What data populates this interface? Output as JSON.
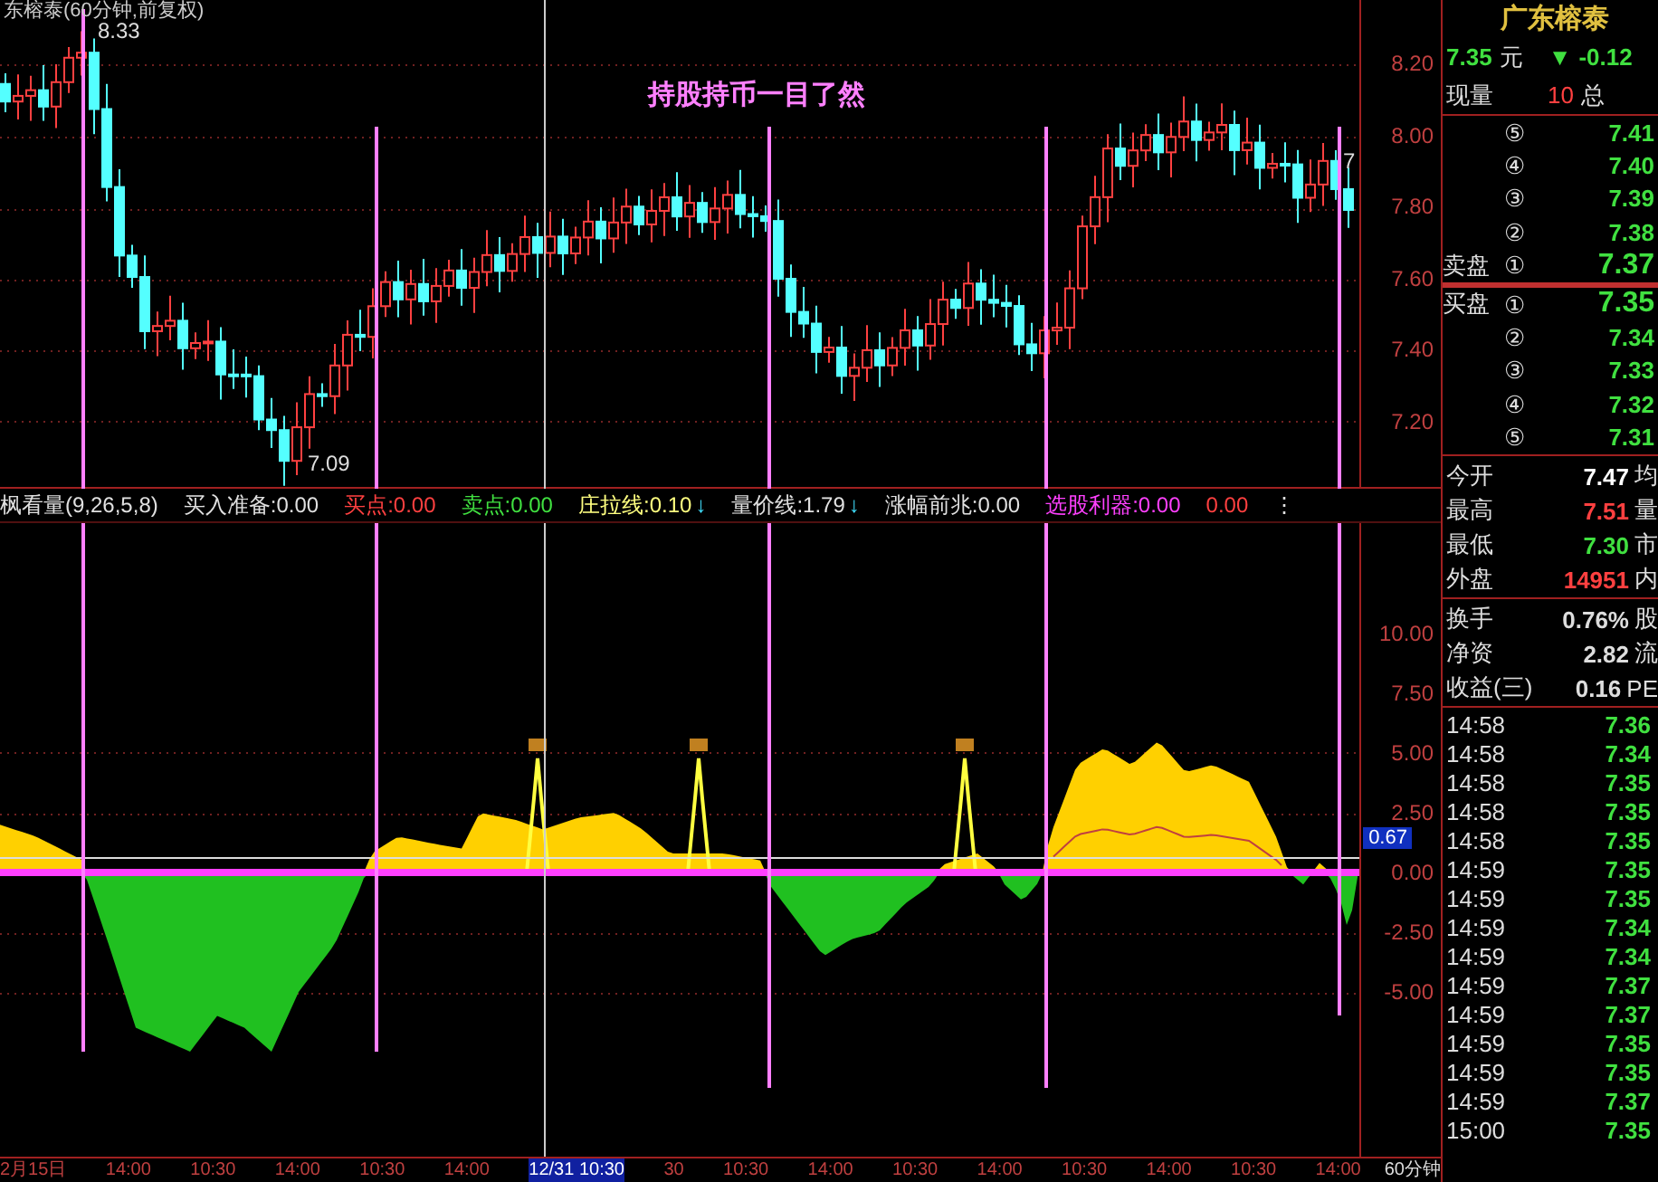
{
  "chart_title": "东榕泰(60分钟,前复权)",
  "banner": "持股持币一目了然",
  "price_marks": {
    "high": "8.33",
    "low": "7.09",
    "last": "7"
  },
  "price_axis": [
    "8.20",
    "8.00",
    "7.80",
    "7.60",
    "7.40",
    "7.20"
  ],
  "indicator_header": [
    {
      "text": "枫看量(9,26,5,8)",
      "kind": "plain"
    },
    {
      "text": "买入准备:0.00",
      "kind": "plain"
    },
    {
      "text": "买点:0.00",
      "kind": "buy"
    },
    {
      "text": "卖点:0.00",
      "kind": "sell"
    },
    {
      "text": "庄拉线:0.10",
      "arrow": "↓",
      "kind": "line"
    },
    {
      "text": "量价线:1.79",
      "arrow": "↓",
      "kind": "plain"
    },
    {
      "text": "涨幅前兆:0.00",
      "kind": "plain"
    },
    {
      "text": "选股利器:0.00",
      "kind": "pick"
    },
    {
      "text": "0.00",
      "kind": "buy"
    },
    {
      "text": "⋮",
      "kind": "plain"
    }
  ],
  "indicator_axis": [
    "10.00",
    "7.50",
    "5.00",
    "2.50",
    "0.00",
    "-2.50",
    "-5.00"
  ],
  "indicator_badge": "0.67",
  "time_axis": [
    {
      "text": "2月15日",
      "selected": false
    },
    {
      "text": "14:00",
      "selected": false
    },
    {
      "text": "10:30",
      "selected": false
    },
    {
      "text": "14:00",
      "selected": false
    },
    {
      "text": "10:30",
      "selected": false
    },
    {
      "text": "14:00",
      "selected": false
    },
    {
      "text": "12/31 10:30",
      "selected": true
    },
    {
      "text": "30",
      "selected": false
    },
    {
      "text": "10:30",
      "selected": false
    },
    {
      "text": "14:00",
      "selected": false
    },
    {
      "text": "10:30",
      "selected": false
    },
    {
      "text": "14:00",
      "selected": false
    },
    {
      "text": "10:30",
      "selected": false
    },
    {
      "text": "14:00",
      "selected": false
    },
    {
      "text": "10:30",
      "selected": false
    },
    {
      "text": "14:00",
      "selected": false
    }
  ],
  "period": "60分钟",
  "quote": {
    "name": "广东榕泰",
    "price": "7.35",
    "unit": "元",
    "change_arrow": "▼",
    "change": "-0.12",
    "volume_label": "现量",
    "volume": "10",
    "total_label": "总"
  },
  "order_book": [
    {
      "position": "⑤",
      "price": "7.41",
      "best": false
    },
    {
      "position": "④",
      "price": "7.40",
      "best": false
    },
    {
      "position": "③",
      "price": "7.39",
      "best": false
    },
    {
      "position": "②",
      "price": "7.38",
      "best": false
    },
    {
      "label": "卖盘",
      "position": "①",
      "price": "7.37",
      "best": true
    },
    {
      "label": "买盘",
      "position": "①",
      "price": "7.35",
      "best": true
    },
    {
      "position": "②",
      "price": "7.34",
      "best": false
    },
    {
      "position": "③",
      "price": "7.33",
      "best": false
    },
    {
      "position": "④",
      "price": "7.32",
      "best": false
    },
    {
      "position": "⑤",
      "price": "7.31",
      "best": false
    }
  ],
  "stats": [
    {
      "label": "今开",
      "value": "7.47",
      "color": "#ffffff",
      "extra": "均"
    },
    {
      "label": "最高",
      "value": "7.51",
      "color": "#ff4040",
      "extra": "量"
    },
    {
      "label": "最低",
      "value": "7.30",
      "color": "#40e040",
      "extra": "市"
    },
    {
      "label": "外盘",
      "value": "14951",
      "color": "#ff4040",
      "extra": "内"
    }
  ],
  "stats2": [
    {
      "label": "换手",
      "value": "0.76%",
      "extra": "股"
    },
    {
      "label": "净资",
      "value": "2.82",
      "extra": "流"
    },
    {
      "label": "收益(三)",
      "value": "0.16",
      "extra": "PE"
    }
  ],
  "ticks": [
    {
      "time": "14:58",
      "price": "7.36"
    },
    {
      "time": "14:58",
      "price": "7.34"
    },
    {
      "time": "14:58",
      "price": "7.35"
    },
    {
      "time": "14:58",
      "price": "7.35"
    },
    {
      "time": "14:58",
      "price": "7.35"
    },
    {
      "time": "14:59",
      "price": "7.35"
    },
    {
      "time": "14:59",
      "price": "7.35"
    },
    {
      "time": "14:59",
      "price": "7.34"
    },
    {
      "time": "14:59",
      "price": "7.34"
    },
    {
      "time": "14:59",
      "price": "7.37"
    },
    {
      "time": "14:59",
      "price": "7.37"
    },
    {
      "time": "14:59",
      "price": "7.35"
    },
    {
      "time": "14:59",
      "price": "7.35"
    },
    {
      "time": "14:59",
      "price": "7.37"
    },
    {
      "time": "15:00",
      "price": "7.35"
    }
  ]
}
